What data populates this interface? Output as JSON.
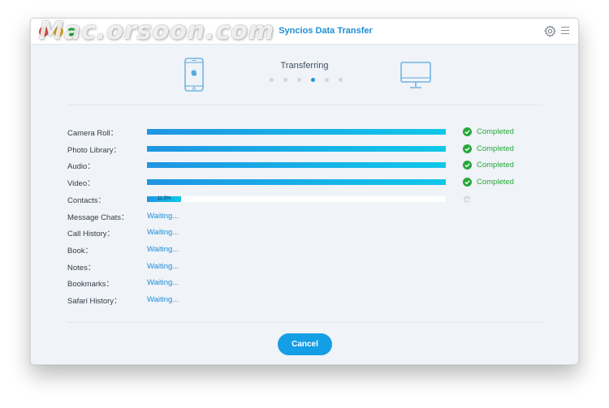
{
  "window": {
    "title": "Syncios Data Transfer",
    "watermark": "Mac.orsoon.com",
    "accent_color": "#1d8fd6",
    "success_color": "#27a83a"
  },
  "toolbar": {
    "settings_icon": "gear-icon",
    "menu_icon": "menu-icon"
  },
  "transfer": {
    "source_device_icon": "iphone-icon",
    "target_device_icon": "computer-monitor-icon",
    "status_title": "Transferring",
    "step_count": 6,
    "active_step": 4
  },
  "items": [
    {
      "label": "Camera Roll：",
      "state": "completed",
      "progress": 1.0,
      "status": "Completed"
    },
    {
      "label": "Photo Library：",
      "state": "completed",
      "progress": 1.0,
      "status": "Completed"
    },
    {
      "label": "Audio：",
      "state": "completed",
      "progress": 1.0,
      "status": "Completed"
    },
    {
      "label": "Video：",
      "state": "completed",
      "progress": 1.0,
      "status": "Completed"
    },
    {
      "label": "Contacts：",
      "state": "in-progress",
      "progress": 0.115,
      "percent_label": "11.5%"
    },
    {
      "label": "Message Chats：",
      "state": "waiting",
      "status": "Waiting..."
    },
    {
      "label": "Call History：",
      "state": "waiting",
      "status": "Waiting..."
    },
    {
      "label": "Book：",
      "state": "waiting",
      "status": "Waiting..."
    },
    {
      "label": "Notes：",
      "state": "waiting",
      "status": "Waiting..."
    },
    {
      "label": "Bookmarks：",
      "state": "waiting",
      "status": "Waiting..."
    },
    {
      "label": "Safari History：",
      "state": "waiting",
      "status": "Waiting..."
    }
  ],
  "actions": {
    "cancel_label": "Cancel"
  }
}
